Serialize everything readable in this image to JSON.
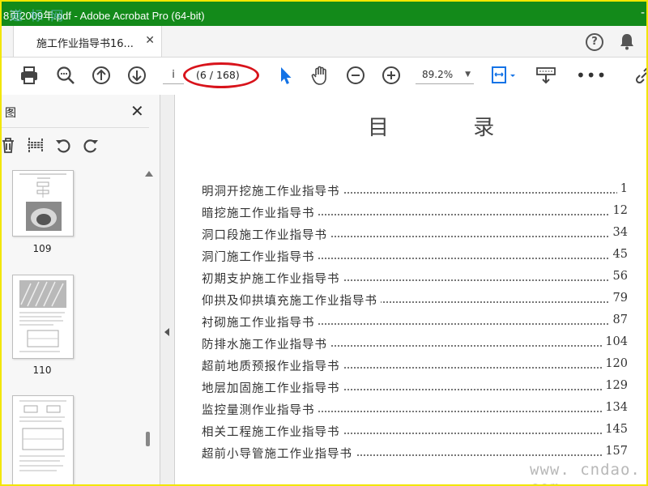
{
  "window": {
    "title": "8页2009年.pdf - Adobe Acrobat Pro (64-bit)",
    "watermark": "道 标 网",
    "dash": "-"
  },
  "tab": {
    "label": "施工作业指导书16...",
    "close": "✕"
  },
  "header": {
    "help_glyph": "?"
  },
  "toolbar": {
    "page_input": "i",
    "page_count": "(6 / 168)",
    "zoom": "89.2%",
    "zoom_caret": "▼",
    "more": "•••",
    "accent_color": "#1473e6",
    "annotation_color": "#d8131b"
  },
  "sidepanel": {
    "title": "图",
    "close": "✕",
    "thumbnails": [
      {
        "label": "109"
      },
      {
        "label": "110"
      },
      {
        "label": ""
      }
    ]
  },
  "document": {
    "title": "目 录",
    "toc": [
      {
        "title": "明洞开挖施工作业指导书",
        "page": "1"
      },
      {
        "title": "暗挖施工作业指导书",
        "page": "12"
      },
      {
        "title": "洞口段施工作业指导书",
        "page": "34"
      },
      {
        "title": "洞门施工作业指导书",
        "page": "45"
      },
      {
        "title": "初期支护施工作业指导书",
        "page": "56"
      },
      {
        "title": "仰拱及仰拱填充施工作业指导书",
        "page": "79"
      },
      {
        "title": "衬砌施工作业指导书",
        "page": "87"
      },
      {
        "title": "防排水施工作业指导书",
        "page": "104"
      },
      {
        "title": "超前地质预报作业指导书",
        "page": "120"
      },
      {
        "title": "地层加固施工作业指导书",
        "page": "129"
      },
      {
        "title": "监控量测作业指导书",
        "page": "134"
      },
      {
        "title": "相关工程施工作业指导书",
        "page": "145"
      },
      {
        "title": "超前小导管施工作业指导书",
        "page": "157"
      }
    ],
    "site_watermark": "www. cndao. com"
  }
}
